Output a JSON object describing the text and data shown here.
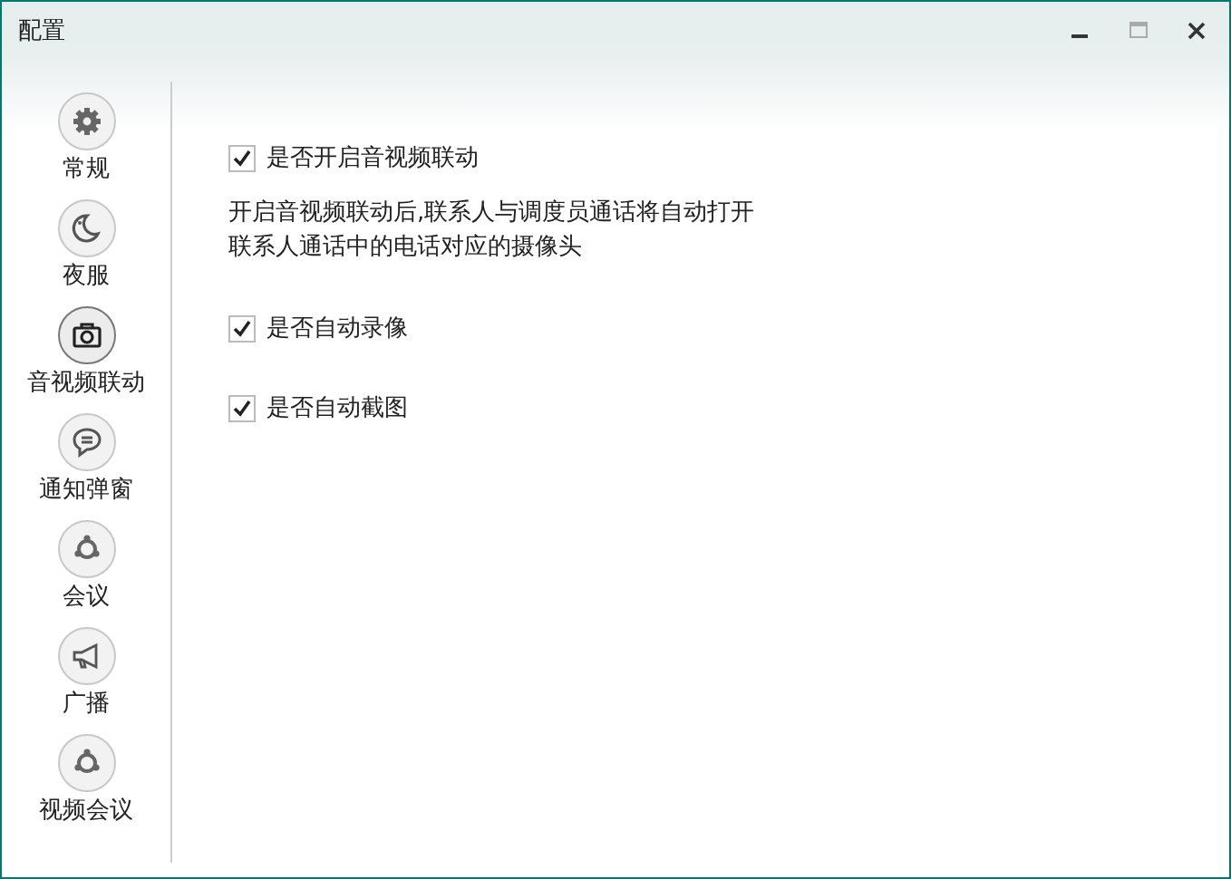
{
  "window": {
    "title": "配置",
    "maximize_disabled": true
  },
  "sidebar": {
    "items": [
      {
        "label": "常规",
        "selected": false
      },
      {
        "label": "夜服",
        "selected": false
      },
      {
        "label": "音视频联动",
        "selected": true
      },
      {
        "label": "通知弹窗",
        "selected": false
      },
      {
        "label": "会议",
        "selected": false
      },
      {
        "label": "广播",
        "selected": false
      },
      {
        "label": "视频会议",
        "selected": false
      }
    ]
  },
  "settings": [
    {
      "kind": "checkbox",
      "label": "是否开启音视频联动",
      "checked": true
    },
    {
      "kind": "note",
      "lines": [
        "开启音视频联动后,联系人与调度员通话将自动打开",
        "联系人通话中的电话对应的摄像头"
      ]
    },
    {
      "kind": "checkbox",
      "label": "是否自动录像",
      "checked": true
    },
    {
      "kind": "checkbox",
      "label": "是否自动截图",
      "checked": true
    }
  ]
}
